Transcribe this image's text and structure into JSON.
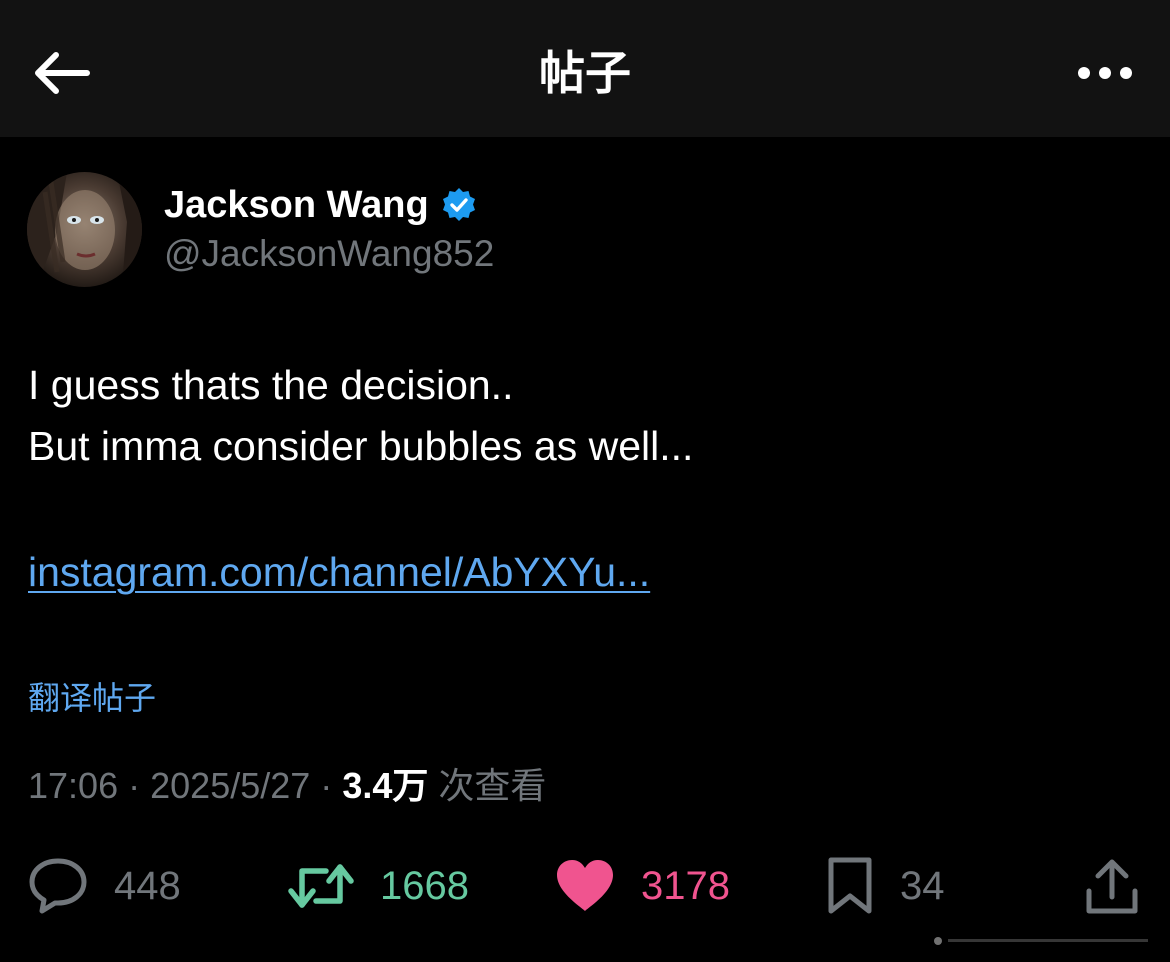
{
  "header": {
    "title": "帖子",
    "back_icon": "back-arrow-icon",
    "more_icon": "more-horizontal-icon",
    "background": "#121212"
  },
  "author": {
    "display_name": "Jackson Wang",
    "handle": "@JacksonWang852",
    "verified": true,
    "verified_color": "#1d9bf0"
  },
  "tweet": {
    "lines": [
      "I guess thats the decision..",
      "But imma consider bubbles as well..."
    ],
    "link_text": "instagram.com/channel/AbYXYu...",
    "translate_label": "翻译帖子"
  },
  "meta": {
    "time": "17:06",
    "separator": "·",
    "date": "2025/5/27",
    "views_count": "3.4万",
    "views_label": "次查看"
  },
  "actions": {
    "replies": "448",
    "retweets": "1668",
    "likes": "3178",
    "bookmarks": "34",
    "retweet_color": "#66c9a0",
    "like_color": "#f0548f",
    "link_color": "#5fa8f0"
  }
}
